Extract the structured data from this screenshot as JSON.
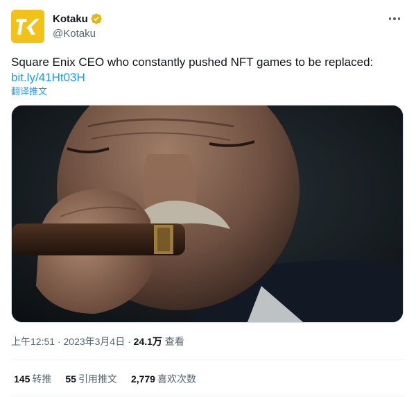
{
  "author": {
    "name": "Kotaku",
    "handle": "@Kotaku",
    "avatar_text": "K",
    "brand_color": "#f2c21a",
    "verified_badge_color": "#e2b719"
  },
  "tweet": {
    "text": "Square Enix CEO who constantly pushed NFT games to be replaced:",
    "link": "bit.ly/41Ht03H",
    "translate_label": "翻译推文",
    "image_icon": "photo-of-man-smoking-cigar"
  },
  "meta": {
    "time": "上午12:51",
    "separator": " · ",
    "date": "2023年3月4日",
    "views_count": "24.1万",
    "views_label": " 查看"
  },
  "stats": [
    {
      "count": "145",
      "label": "转推"
    },
    {
      "count": "55",
      "label": "引用推文"
    },
    {
      "count": "2,779",
      "label": "喜欢次数"
    }
  ],
  "colors": {
    "link": "#1d9bf0",
    "secondary_text": "#536471",
    "divider": "#eff3f4"
  }
}
